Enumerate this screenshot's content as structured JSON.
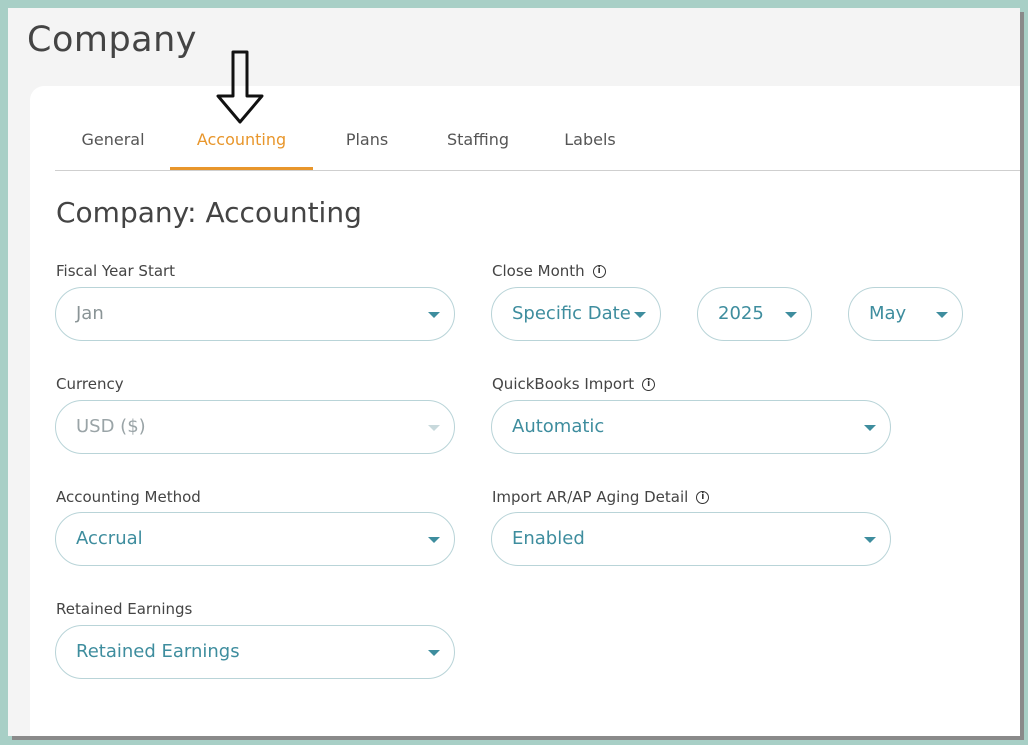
{
  "page": {
    "title": "Company"
  },
  "tabs": [
    {
      "label": "General",
      "active": false
    },
    {
      "label": "Accounting",
      "active": true
    },
    {
      "label": "Plans",
      "active": false
    },
    {
      "label": "Staffing",
      "active": false
    },
    {
      "label": "Labels",
      "active": false
    }
  ],
  "section": {
    "title": "Company: Accounting"
  },
  "fields": {
    "fiscal_year_start": {
      "label": "Fiscal Year Start",
      "value": "Jan"
    },
    "close_month": {
      "label": "Close Month",
      "mode": "Specific Date",
      "year": "2025",
      "month": "May"
    },
    "currency": {
      "label": "Currency",
      "value": "USD ($)"
    },
    "quickbooks_import": {
      "label": "QuickBooks Import",
      "value": "Automatic"
    },
    "accounting_method": {
      "label": "Accounting Method",
      "value": "Accrual"
    },
    "import_aging": {
      "label": "Import AR/AP Aging Detail",
      "value": "Enabled"
    },
    "retained_earnings": {
      "label": "Retained Earnings",
      "value": "Retained Earnings"
    }
  },
  "icons": {
    "info": "info-icon",
    "caret": "chevron-down-icon",
    "annotation": "down-arrow-icon"
  },
  "colors": {
    "accent": "#e8962b",
    "value_text": "#3e8d9e",
    "border": "#b9d4d8",
    "background": "#a8cfc6"
  }
}
